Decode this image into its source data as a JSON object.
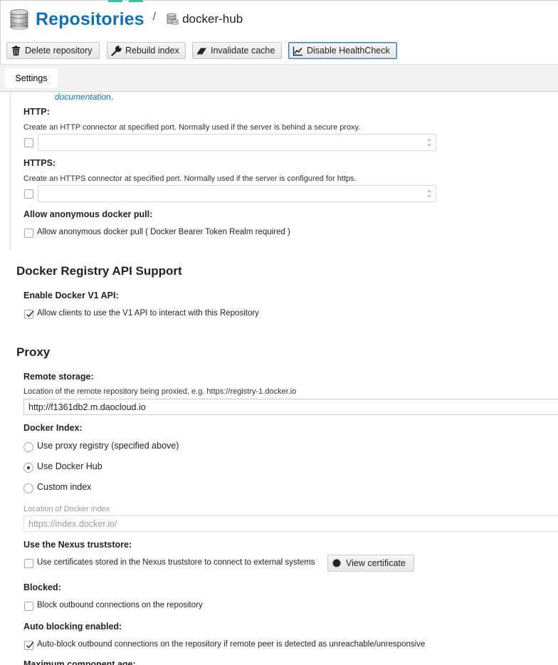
{
  "header": {
    "title": "Repositories",
    "separator": "/",
    "repo_name": "docker-hub"
  },
  "toolbar": {
    "delete_label": "Delete repository",
    "rebuild_label": "Rebuild index",
    "invalidate_label": "Invalidate cache",
    "healthcheck_label": "Disable HealthCheck"
  },
  "tabs": [
    {
      "label": "Settings"
    }
  ],
  "connectors": {
    "doc_link": "documentation",
    "doc_period": ".",
    "http": {
      "label": "HTTP:",
      "help": "Create an HTTP connector at specified port. Normally used if the server is behind a secure proxy.",
      "checked": false,
      "value": ""
    },
    "https": {
      "label": "HTTPS:",
      "help": "Create an HTTPS connector at specified port. Normally used if the server is configured for https.",
      "checked": false,
      "value": ""
    },
    "anonymous": {
      "label": "Allow anonymous docker pull:",
      "checkbox_text": "Allow anonymous docker pull ( Docker Bearer Token Realm required )",
      "checked": false
    }
  },
  "docker_api": {
    "section_title": "Docker Registry API Support",
    "v1_label": "Enable Docker V1 API:",
    "v1_checkbox_text": "Allow clients to use the V1 API to interact with this Repository",
    "v1_checked": true
  },
  "proxy": {
    "section_title": "Proxy",
    "remote_label": "Remote storage:",
    "remote_help": "Location of the remote repository being proxied, e.g. https://registry-1.docker.io",
    "remote_value": "http://f1361db2.m.daocloud.io",
    "index_label": "Docker Index:",
    "index_options": [
      {
        "label": "Use proxy registry (specified above)",
        "selected": false
      },
      {
        "label": "Use Docker Hub",
        "selected": true
      },
      {
        "label": "Custom index",
        "selected": false
      }
    ],
    "index_location_label": "Location of Docker index",
    "index_location_value": "https://index.docker.io/",
    "truststore_label": "Use the Nexus truststore:",
    "truststore_checkbox_text": "Use certificates stored in the Nexus truststore to connect to external systems",
    "truststore_checked": false,
    "view_cert_label": "View certificate",
    "blocked_label": "Blocked:",
    "blocked_checkbox_text": "Block outbound connections on the repository",
    "blocked_checked": false,
    "auto_block_label": "Auto blocking enabled:",
    "auto_block_checkbox_text": "Auto-block outbound connections on the repository if remote peer is detected as unreachable/unresponsive",
    "auto_block_checked": true,
    "max_age_label": "Maximum component age:"
  },
  "colors": {
    "brand_blue": "#1170b4",
    "accent_teal": "#37c0a6"
  }
}
